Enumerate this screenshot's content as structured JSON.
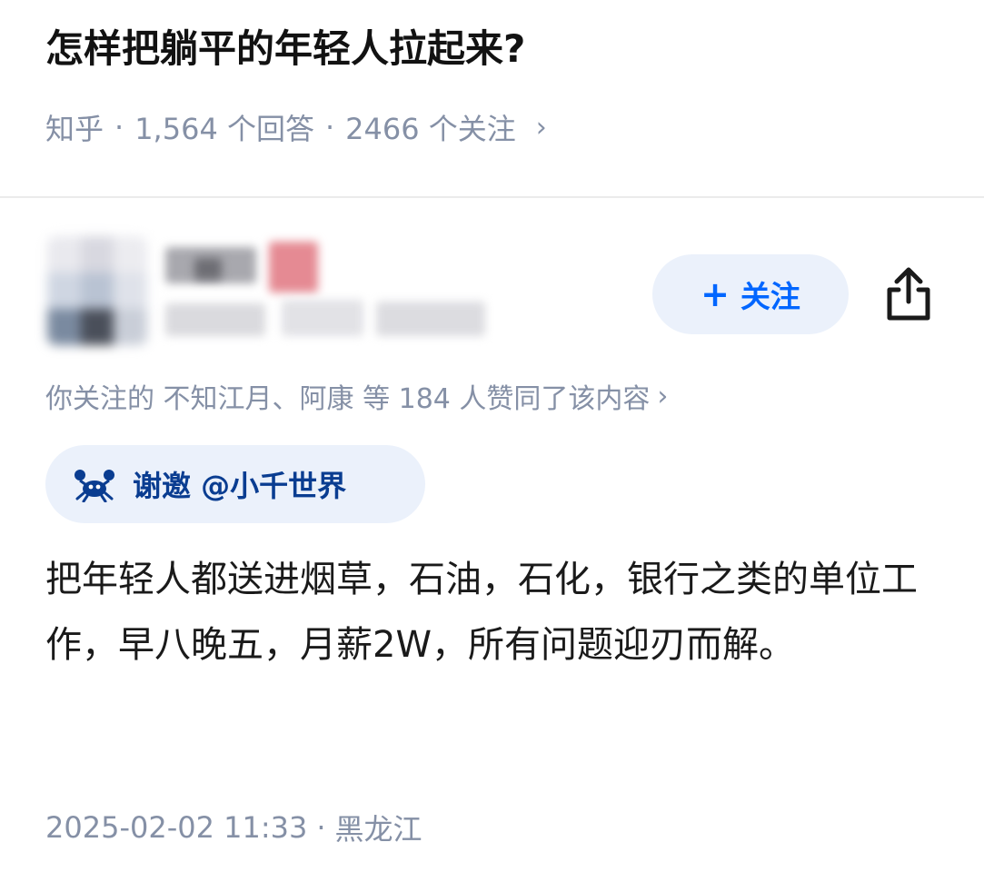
{
  "question": {
    "title": "怎样把躺平的年轻人拉起来?",
    "source": "知乎",
    "answers": "1,564 个回答",
    "followers": "2466 个关注",
    "separator": "·",
    "chevron": "›"
  },
  "author": {
    "follow_label": "关注",
    "follow_plus": "+",
    "share_icon": "share-icon"
  },
  "likers": {
    "text": "你关注的 不知江月、阿康 等 184 人赞同了该内容",
    "chevron": "›"
  },
  "invite": {
    "icon": "crab-icon",
    "text": "谢邀 @小千世界"
  },
  "answer": {
    "content": "把年轻人都送进烟草，石油，石化，银行之类的单位工作，早八晚五，月薪2W，所有问题迎刃而解。"
  },
  "footer": {
    "timestamp": "2025-02-02 11:33",
    "separator": "·",
    "location": "黑龙江"
  },
  "colors": {
    "accent": "#0066ff",
    "meta_gray": "#8590a6",
    "chip_bg": "#ebf1fb"
  }
}
